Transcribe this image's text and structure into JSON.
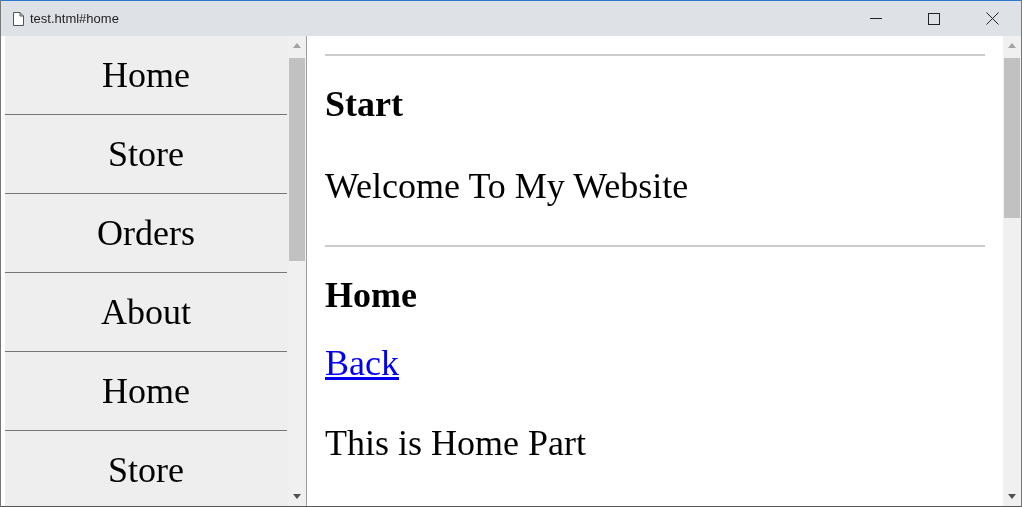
{
  "window": {
    "title": "test.html#home"
  },
  "sidebar": {
    "items": [
      {
        "label": "Home"
      },
      {
        "label": "Store"
      },
      {
        "label": "Orders"
      },
      {
        "label": "About"
      },
      {
        "label": "Home"
      },
      {
        "label": "Store"
      }
    ]
  },
  "content": {
    "sections": [
      {
        "heading": "Start",
        "blocks": [
          {
            "kind": "text",
            "text": "Welcome To My Website"
          }
        ]
      },
      {
        "heading": "Home",
        "blocks": [
          {
            "kind": "link",
            "text": "Back"
          },
          {
            "kind": "text",
            "text": "This is Home Part"
          }
        ]
      }
    ]
  }
}
